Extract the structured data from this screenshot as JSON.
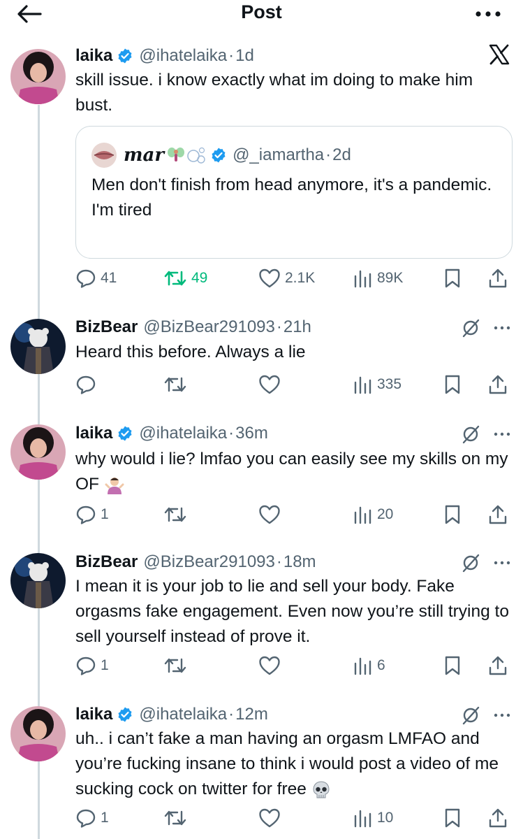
{
  "header": {
    "title": "Post",
    "back_icon": "arrow-left-icon",
    "more_icon": "ellipsis-icon"
  },
  "brand": {
    "logo_icon": "x-logo-icon"
  },
  "colors": {
    "verified": "#1d9bf0",
    "retweet_active": "#00ba7c",
    "muted": "#536471",
    "border": "#cfd9de"
  },
  "main_post": {
    "name": "laika",
    "handle": "@ihatelaika",
    "time": "1d",
    "text": "skill issue. i know exactly what im doing to make him bust.",
    "quote": {
      "name": "mar",
      "handle": "@_iamartha",
      "time": "2d",
      "lines": [
        "Men don't finish from head anymore, it's a pandemic.",
        "I'm tired"
      ]
    },
    "stats": {
      "replies": "41",
      "reposts": "49",
      "likes": "2.1K",
      "views": "89K"
    }
  },
  "replies": [
    {
      "name": "BizBear",
      "handle": "@BizBear291093",
      "time": "21h",
      "text": "Heard this before. Always a lie",
      "stats": {
        "replies": "",
        "reposts": "",
        "likes": "",
        "views": "335"
      }
    },
    {
      "name": "laika",
      "handle": "@ihatelaika",
      "time": "36m",
      "text": "why would i lie? lmfao you can easily see my skills on my OF",
      "stats": {
        "replies": "1",
        "reposts": "",
        "likes": "",
        "views": "20"
      }
    },
    {
      "name": "BizBear",
      "handle": "@BizBear291093",
      "time": "18m",
      "text": "I mean it is your job to lie and sell your body. Fake orgasms fake engagement. Even now you’re still trying to sell yourself instead of prove it.",
      "stats": {
        "replies": "1",
        "reposts": "",
        "likes": "",
        "views": "6"
      }
    },
    {
      "name": "laika",
      "handle": "@ihatelaika",
      "time": "12m",
      "text": "uh.. i can’t fake a man having an orgasm LMFAO and you’re fucking insane to think i would post a video of me sucking cock on twitter for free",
      "stats": {
        "replies": "1",
        "reposts": "",
        "likes": "",
        "views": "10"
      }
    }
  ]
}
